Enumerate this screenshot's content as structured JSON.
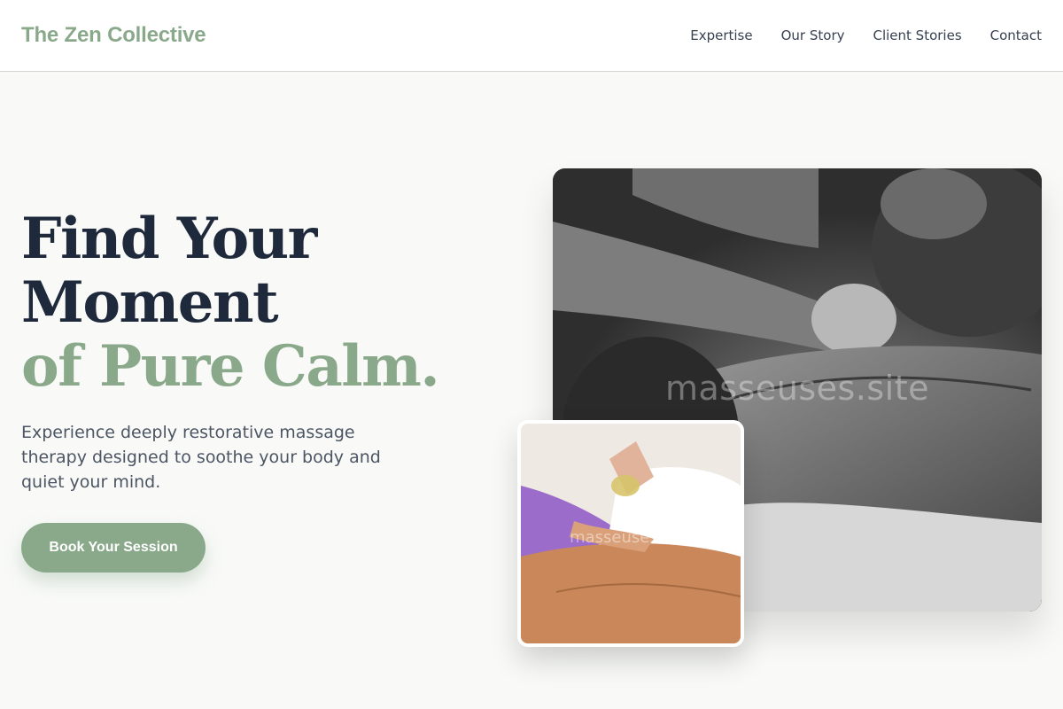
{
  "header": {
    "brand": "The Zen Collective",
    "nav": [
      {
        "label": "Expertise"
      },
      {
        "label": "Our Story"
      },
      {
        "label": "Client Stories"
      },
      {
        "label": "Contact"
      }
    ]
  },
  "hero": {
    "title_line1": "Find Your",
    "title_line2": "Moment",
    "title_line3": "of Pure Calm.",
    "subtitle": "Experience deeply restorative massage therapy designed to soothe your body and quiet your mind.",
    "cta_label": "Book Your Session"
  },
  "images": {
    "main_watermark": "masseuses.site",
    "small_watermark": "masseuses.site"
  },
  "colors": {
    "accent": "#8aa98b",
    "heading": "#1e293b",
    "background": "#f9faf8"
  }
}
